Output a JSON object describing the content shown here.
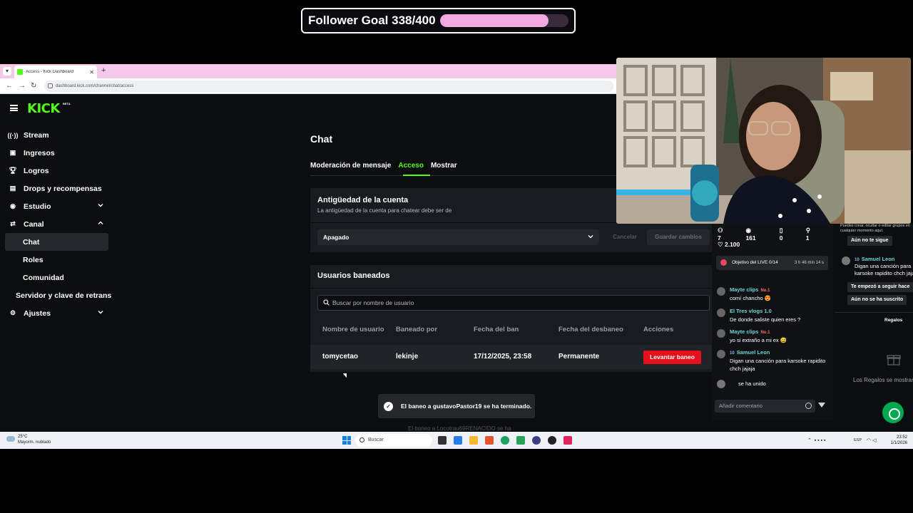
{
  "overlay": {
    "goal_label": "Follower Goal 338/400",
    "goal_progress": 0.845
  },
  "browser": {
    "tab_title": "Access - Kick Dashboard",
    "url": "dashboard.kick.com/channel/chat/access"
  },
  "brand": {
    "logo": "KICK",
    "beta": "BETA",
    "accent": "#53fc18"
  },
  "sidebar": {
    "items": [
      {
        "label": "Stream",
        "icon": "broadcast-icon"
      },
      {
        "label": "Ingresos",
        "icon": "wallet-icon"
      },
      {
        "label": "Logros",
        "icon": "trophy-icon"
      },
      {
        "label": "Drops y recompensas",
        "icon": "gift-icon"
      },
      {
        "label": "Estudio",
        "icon": "studio-icon",
        "expanded": false
      },
      {
        "label": "Canal",
        "icon": "channel-icon",
        "expanded": true
      },
      {
        "label": "Chat",
        "active": true
      },
      {
        "label": "Roles"
      },
      {
        "label": "Comunidad"
      },
      {
        "label": "Servidor y clave de retrans"
      },
      {
        "label": "Ajustes",
        "icon": "gear-icon",
        "expanded": false
      }
    ]
  },
  "page": {
    "title": "Chat",
    "tabs": [
      "Moderación de mensaje",
      "Acceso",
      "Mostrar"
    ],
    "active_tab": "Acceso"
  },
  "account_age": {
    "title": "Antigüedad de la cuenta",
    "subtitle": "La antigüedad de la cuenta para chatear debe ser de",
    "selected": "Apagado",
    "cancel_label": "Cancelar",
    "save_label": "Guardar cambios"
  },
  "banned": {
    "title": "Usuarios baneados",
    "search_placeholder": "Buscar por nombre de usuario",
    "columns": [
      "Nombre de usuario",
      "Baneado por",
      "Fecha del ban",
      "Fecha del desbaneo",
      "Acciones"
    ],
    "rows": [
      {
        "user": "tomycetao",
        "by": "lekinje",
        "date": "17/12/2025, 23:58",
        "unban_date": "Permanente",
        "action": "Levantar baneo"
      }
    ]
  },
  "toasts": [
    "El baneo a gustavoPastor19 se ha terminado.",
    "El baneo a Locotrau69RENACIDO se ha"
  ],
  "chat": {
    "stats": {
      "viewers": "7",
      "views": "161",
      "clips": "0",
      "followers": "1"
    },
    "likes": "2.100",
    "objective": {
      "label": "Objetivo del LIVE",
      "progress": "0/14",
      "time": "3 h 46 min 14 s"
    },
    "messages": [
      {
        "user": "Mayte clips",
        "badge": "No.1",
        "text": "comí chancho 😍",
        "color": "#6ad6d8"
      },
      {
        "user": "El Tres vlogs 1.0",
        "badge": "",
        "text": "De donde saliste quien eres ?",
        "color": "#6ad6d8"
      },
      {
        "user": "Mayte clips",
        "badge": "No.1",
        "text": "yo si extraño a mi ex 😅",
        "color": "#6ad6d8"
      },
      {
        "user": "Samuel Leon",
        "badge": "10",
        "text": "Digan una canción para karsoke rapidito chch jajaja",
        "color": "#6ad6d8"
      }
    ],
    "join_text": "se ha unido",
    "comment_placeholder": "Añadir comentario"
  },
  "chat_right": {
    "tooltip": "Puedes crear, ocultar o editar grupos en cualquier momento aquí.",
    "pill_1": "Aún no te sigue",
    "msg_user": "Samuel Leon",
    "msg_badge": "10",
    "msg_text": "Digan una canción para karsoke rapidito chch jajaja",
    "pill_2": "Te empezó a seguir hace",
    "pill_3": "Aún no se ha suscrito",
    "gifts_title": "Regalos",
    "gifts_empty": "Los Regalos se mostrarán"
  },
  "taskbar": {
    "temp": "25°C",
    "weather": "Mayorm. nublado",
    "search": "Buscar",
    "lang": "ESP",
    "time": "23:52",
    "date": "1/1/2026"
  }
}
